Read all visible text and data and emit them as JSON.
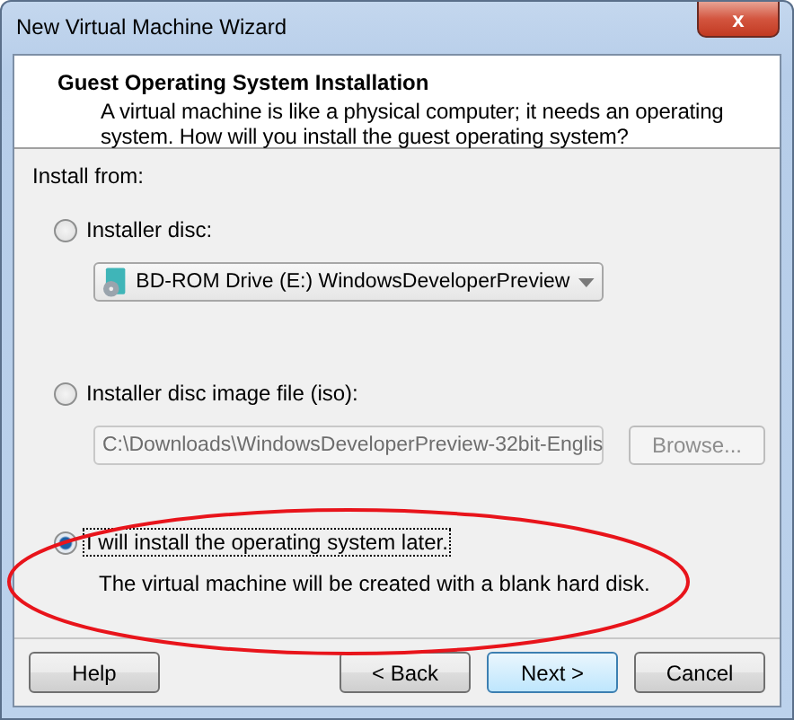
{
  "window": {
    "title": "New Virtual Machine Wizard",
    "close": "x"
  },
  "header": {
    "title": "Guest Operating System Installation",
    "description": "A virtual machine is like a physical computer; it needs an operating system. How will you install the guest operating system?"
  },
  "install_from": {
    "label": "Install from:",
    "options": [
      {
        "kind": "disc",
        "label": "Installer disc:",
        "selected": false,
        "drive": {
          "value": "BD-ROM Drive (E:) WindowsDeveloperPreview",
          "disabled": false
        }
      },
      {
        "kind": "iso",
        "label": "Installer disc image file (iso):",
        "selected": false,
        "path": {
          "value": "C:\\Downloads\\WindowsDeveloperPreview-32bit-Englis",
          "disabled": true
        },
        "browse": {
          "label": "Browse...",
          "disabled": true
        }
      },
      {
        "kind": "later",
        "label": "I will install the operating system later.",
        "selected": true,
        "note": "The virtual machine will be created with a blank hard disk."
      }
    ]
  },
  "annotation": {
    "kind": "ellipse",
    "color": "#e8141b"
  },
  "buttons": [
    {
      "label": "Help",
      "default": false
    },
    {
      "label": "< Back",
      "default": false
    },
    {
      "label": "Next >",
      "default": true
    },
    {
      "label": "Cancel",
      "default": false
    }
  ]
}
